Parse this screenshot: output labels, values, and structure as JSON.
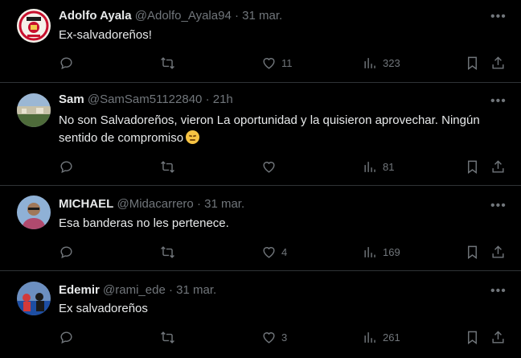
{
  "tweets": [
    {
      "name": "Adolfo Ayala",
      "handle": "@Adolfo_Ayala94",
      "sep": "·",
      "time": "31 mar.",
      "text": "Ex-salvadoreños!",
      "replies": "",
      "retweets": "",
      "likes": "11",
      "views": "323",
      "avatar_colors": [
        "#c8102e",
        "#ffffff",
        "#f2c94c"
      ]
    },
    {
      "name": "Sam",
      "handle": "@SamSam51122840",
      "sep": "·",
      "time": "21h",
      "text": "No son Salvadoreños, vieron La oportunidad y la quisieron aprovechar. Ningún sentido de compromiso",
      "emoji": "confounded-face",
      "replies": "",
      "retweets": "",
      "likes": "",
      "views": "81",
      "avatar_colors": [
        "#6b8fb5",
        "#4e6b3a",
        "#c7c1a8"
      ]
    },
    {
      "name": "MICHAEL",
      "handle": "@Midacarrero",
      "sep": "·",
      "time": "31 mar.",
      "text": "Esa banderas no les pertenece.",
      "replies": "",
      "retweets": "",
      "likes": "4",
      "views": "169",
      "avatar_colors": [
        "#8fb1d6",
        "#3a2a22",
        "#b04a6e"
      ]
    },
    {
      "name": "Edemir",
      "handle": "@rami_ede",
      "sep": "·",
      "time": "31 mar.",
      "text": "Ex salvadoreños",
      "replies": "",
      "retweets": "",
      "likes": "3",
      "views": "261",
      "avatar_colors": [
        "#1d4ea3",
        "#d23a3a",
        "#1a1a1a"
      ]
    }
  ],
  "icons": {
    "more": "more-dots-icon",
    "reply": "reply-bubble-icon",
    "retweet": "retweet-icon",
    "like": "heart-icon",
    "views": "views-bars-icon",
    "bookmark": "bookmark-icon",
    "share": "share-icon"
  },
  "colors": {
    "background": "#000000",
    "text": "#e7e9ea",
    "muted": "#71767b",
    "divider": "#2f3336"
  }
}
